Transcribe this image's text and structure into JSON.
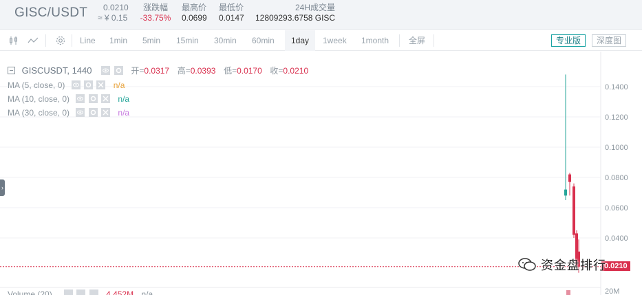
{
  "ticker": {
    "pair": "GISC/USDT",
    "last_price": "0.0210",
    "cny_price": "≈ ¥ 0.15",
    "change_label": "涨跌幅",
    "change_value": "-33.75%",
    "high_label": "最高价",
    "high_value": "0.0699",
    "low_label": "最低价",
    "low_value": "0.0147",
    "volume_label": "24H成交量",
    "volume_value": "12809293.6758 GISC"
  },
  "toolbar": {
    "bar_icon": "candlestick-icon",
    "line_icon": "line-chart-icon",
    "settings_icon": "gear-icon",
    "intervals": [
      "Line",
      "1min",
      "5min",
      "15min",
      "30min",
      "60min",
      "1day",
      "1week",
      "1month"
    ],
    "active_interval": "1day",
    "fullscreen": "全屏",
    "pro_mode": "专业版",
    "depth_mode": "深度图"
  },
  "legend": {
    "symbol": "GISCUSDT, 1440",
    "open_label": "开=",
    "open_value": "0.0317",
    "high_label": "高=",
    "high_value": "0.0393",
    "low_label": "低=",
    "low_value": "0.0170",
    "close_label": "收=",
    "close_value": "0.0210",
    "ma": [
      {
        "label": "MA (5, close, 0)",
        "value": "n/a",
        "color": "#e8a23a"
      },
      {
        "label": "MA (10, close, 0)",
        "value": "n/a",
        "color": "#26a69a"
      },
      {
        "label": "MA (30, close, 0)",
        "value": "n/a",
        "color": "#c77ae0"
      }
    ],
    "volume_label": "Volume (20)",
    "volume_value": "4.452M",
    "volume_ma": "n/a"
  },
  "price_axis": {
    "ticks": [
      "0.1400",
      "0.1200",
      "0.1000",
      "0.0800",
      "0.0600",
      "0.0400"
    ],
    "current_tag": "0.0210",
    "volume_tick": "20M"
  },
  "chart_data": {
    "type": "candlestick",
    "ylim": [
      0.015,
      0.15
    ],
    "candles": [
      {
        "open": 0.068,
        "high": 0.148,
        "low": 0.065,
        "close": 0.072
      },
      {
        "open": 0.082,
        "high": 0.083,
        "low": 0.068,
        "close": 0.077
      },
      {
        "open": 0.074,
        "high": 0.076,
        "low": 0.04,
        "close": 0.042
      },
      {
        "open": 0.043,
        "high": 0.045,
        "low": 0.02,
        "close": 0.022
      },
      {
        "open": 0.031,
        "high": 0.039,
        "low": 0.017,
        "close": 0.021
      }
    ],
    "current_price": 0.021
  },
  "watermark": {
    "icon": "wechat-icon",
    "text": "资金盘排行"
  },
  "colors": {
    "up": "#26a69a",
    "down": "#d9304e",
    "accent": "#1aa3a3"
  }
}
